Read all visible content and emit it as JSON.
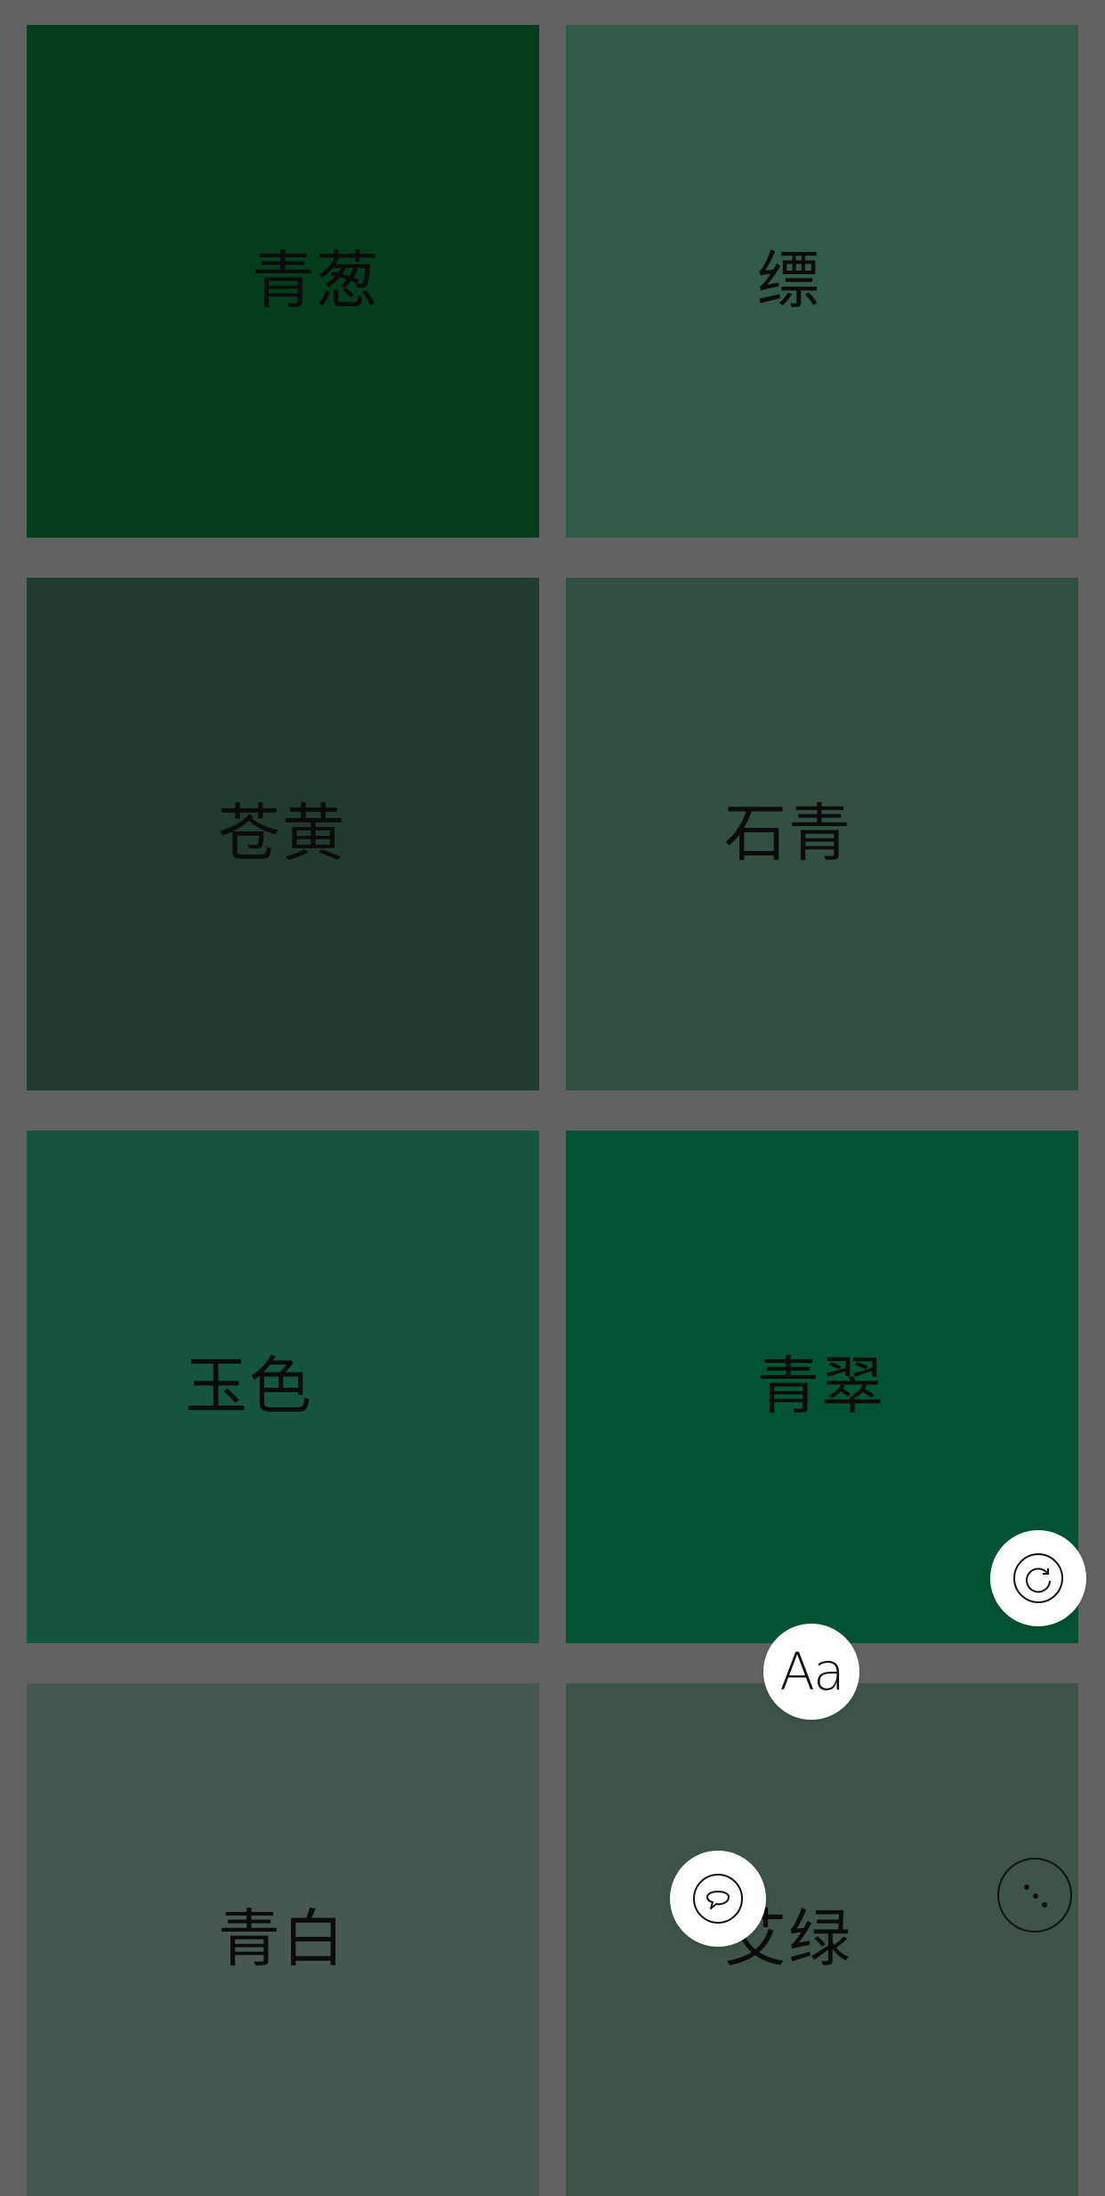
{
  "tiles": [
    {
      "name": "青葱",
      "color": "#053c1c"
    },
    {
      "name": "缥",
      "color": "#325b47"
    },
    {
      "name": "苍黄",
      "color": "#213c2e"
    },
    {
      "name": "石青",
      "color": "#315042"
    },
    {
      "name": "玉色",
      "color": "#145440"
    },
    {
      "name": "青翠",
      "color": "#005432"
    },
    {
      "name": "青白",
      "color": "#475852"
    },
    {
      "name": "艾绿",
      "color": "#3e5449"
    }
  ],
  "buttons": {
    "font": {
      "label": "Aa",
      "icon": "font-icon"
    },
    "refresh": {
      "icon": "refresh-icon"
    },
    "comment": {
      "icon": "speech-bubble-icon"
    },
    "more": {
      "icon": "more-dots-icon"
    }
  }
}
